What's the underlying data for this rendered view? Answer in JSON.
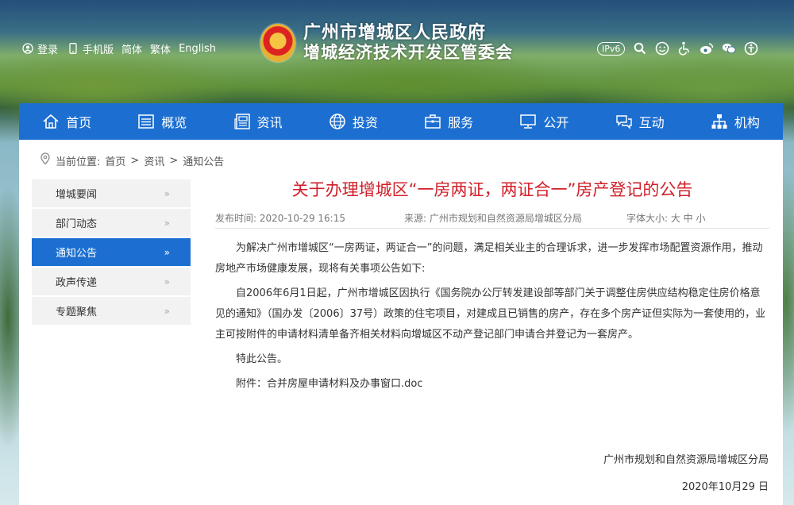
{
  "topbar": {
    "login": "登录",
    "mobile": "手机版",
    "simplified": "简体",
    "traditional": "繁体",
    "english": "English",
    "ipv6": "IPv6"
  },
  "brand": {
    "line1": "广州市增城区人民政府",
    "line2": "增城经济技术开发区管委会"
  },
  "nav": [
    {
      "label": "首页",
      "icon": "home-icon"
    },
    {
      "label": "概览",
      "icon": "list-icon"
    },
    {
      "label": "资讯",
      "icon": "news-icon"
    },
    {
      "label": "投资",
      "icon": "globe-icon"
    },
    {
      "label": "服务",
      "icon": "briefcase-icon"
    },
    {
      "label": "公开",
      "icon": "monitor-icon"
    },
    {
      "label": "互动",
      "icon": "chat-icon"
    },
    {
      "label": "机构",
      "icon": "org-icon"
    }
  ],
  "breadcrumb": {
    "prefix": "当前位置:",
    "items": [
      "首页",
      "资讯",
      "通知公告"
    ],
    "sep": ">"
  },
  "sidebar": {
    "items": [
      "增城要闻",
      "部门动态",
      "通知公告",
      "政声传递",
      "专题聚焦"
    ],
    "active_index": 2,
    "arrow": "»"
  },
  "article": {
    "title": "关于办理增城区“一房两证，两证合一”房产登记的公告",
    "publish_time": "发布时间: 2020-10-29 16:15",
    "source": "来源: 广州市规划和自然资源局增城区分局",
    "font_size": "字体大小: 大 中 小",
    "paragraphs": [
      "为解决广州市增城区“一房两证，两证合一”的问题，满足相关业主的合理诉求，进一步发挥市场配置资源作用，推动房地产市场健康发展，现将有关事项公告如下:",
      "自2006年6月1日起，广州市增城区因执行《国务院办公厅转发建设部等部门关于调整住房供应结构稳定住房价格意见的通知》（国办发〔2006〕37号）政策的住宅项目，对建成且已销售的房产，存在多个房产证但实际为一套使用的，业主可按附件的申请材料清单备齐相关材料向增城区不动产登记部门申请合并登记为一套房产。",
      "特此公告。",
      "附件：合并房屋申请材料及办事窗口.doc"
    ],
    "signature_org": "广州市规划和自然资源局增城区分局",
    "signature_date": "2020年10月29 日"
  },
  "colors": {
    "nav_bg": "#1c6fd1",
    "title_red": "#d0202a"
  }
}
